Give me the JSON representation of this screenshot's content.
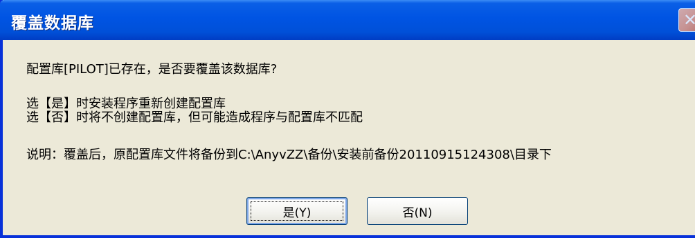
{
  "window": {
    "title": "覆盖数据库",
    "close_label": "✕"
  },
  "message": {
    "question": "配置库[PILOT]已存在，是否要覆盖该数据库?",
    "line_yes": "选【是】时安装程序重新创建配置库",
    "line_no": "选【否】时将不创建配置库，但可能造成程序与配置库不匹配",
    "note": "说明：覆盖后，原配置库文件将备份到C:\\AnyvZZ\\备份\\安装前备份20110915124308\\目录下"
  },
  "buttons": {
    "yes_label": "是(Y)",
    "no_label": "否(N)"
  }
}
